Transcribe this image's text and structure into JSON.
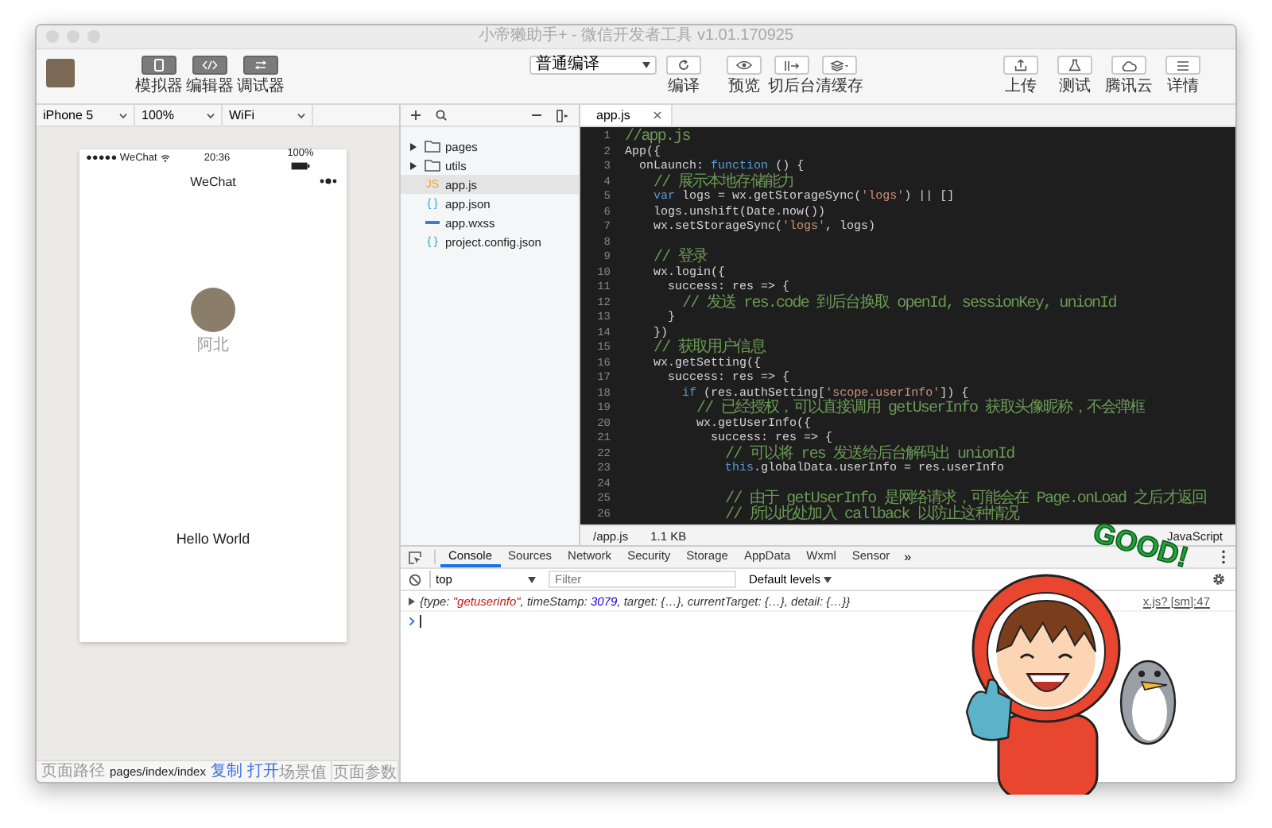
{
  "window": {
    "title": "小帝獭助手+ - 微信开发者工具 v1.01.170925"
  },
  "toolbar": {
    "left_buttons": [
      {
        "label": "模拟器",
        "kind": "simulator"
      },
      {
        "label": "编辑器",
        "kind": "editor"
      },
      {
        "label": "调试器",
        "kind": "debugger"
      }
    ],
    "compile_mode": "普通编译",
    "center_buttons": [
      {
        "label": "编译",
        "kind": "refresh"
      },
      {
        "label": "预览",
        "kind": "eye"
      },
      {
        "label": "切后台",
        "kind": "background"
      },
      {
        "label": "清缓存",
        "kind": "cache"
      }
    ],
    "right_buttons": [
      {
        "label": "上传",
        "kind": "upload"
      },
      {
        "label": "测试",
        "kind": "flask"
      },
      {
        "label": "腾讯云",
        "kind": "cloud"
      },
      {
        "label": "详情",
        "kind": "menu"
      }
    ]
  },
  "device_bar": {
    "device": "iPhone 5",
    "zoom": "100%",
    "network": "WiFi"
  },
  "simulator": {
    "carrier": "●●●●● WeChat",
    "time": "20:36",
    "battery": "100%",
    "nav_title": "WeChat",
    "user_name": "阿北",
    "greeting": "Hello World"
  },
  "path_bar": {
    "label": "页面路径",
    "path": "pages/index/index",
    "links": [
      "复制",
      "打开"
    ],
    "scene": "场景值",
    "params": "页面参数"
  },
  "file_tree": {
    "items": [
      {
        "name": "pages",
        "kind": "folder",
        "expanded": false,
        "selected": false
      },
      {
        "name": "utils",
        "kind": "folder",
        "expanded": false,
        "selected": false
      },
      {
        "name": "app.js",
        "kind": "js",
        "badge": "JS",
        "selected": true
      },
      {
        "name": "app.json",
        "kind": "json",
        "badge": "{ }",
        "selected": false
      },
      {
        "name": "app.wxss",
        "kind": "wxss",
        "selected": false
      },
      {
        "name": "project.config.json",
        "kind": "json",
        "badge": "{ }",
        "selected": false
      }
    ]
  },
  "editor": {
    "tabs": [
      {
        "label": "app.js",
        "selected": true
      }
    ],
    "lines": [
      {
        "number": "1",
        "tokens": [
          {
            "kind": "comment",
            "text": "//app.js"
          }
        ]
      },
      {
        "number": "2",
        "tokens": [
          {
            "kind": "plain",
            "text": "App({"
          }
        ]
      },
      {
        "number": "3",
        "tokens": [
          {
            "kind": "plain",
            "text": "  onLaunch: "
          },
          {
            "kind": "keyword",
            "text": "function"
          },
          {
            "kind": "plain",
            "text": " () {"
          }
        ]
      },
      {
        "number": "4",
        "tokens": [
          {
            "kind": "comment",
            "text": "    // 展示本地存储能力"
          }
        ]
      },
      {
        "number": "5",
        "tokens": [
          {
            "kind": "keyword",
            "text": "    var"
          },
          {
            "kind": "plain",
            "text": " logs = wx.getStorageSync("
          },
          {
            "kind": "string",
            "text": "'logs'"
          },
          {
            "kind": "plain",
            "text": ") || []"
          }
        ]
      },
      {
        "number": "6",
        "tokens": [
          {
            "kind": "plain",
            "text": "    logs.unshift(Date.now())"
          }
        ]
      },
      {
        "number": "7",
        "tokens": [
          {
            "kind": "plain",
            "text": "    wx.setStorageSync("
          },
          {
            "kind": "string",
            "text": "'logs'"
          },
          {
            "kind": "plain",
            "text": ", logs)"
          }
        ]
      },
      {
        "number": "8"
      },
      {
        "number": "9",
        "tokens": [
          {
            "kind": "comment",
            "text": "    // 登录"
          }
        ]
      },
      {
        "number": "10",
        "tokens": [
          {
            "kind": "plain",
            "text": "    wx.login({"
          }
        ]
      },
      {
        "number": "11",
        "tokens": [
          {
            "kind": "plain",
            "text": "      success: res => {"
          }
        ]
      },
      {
        "number": "12",
        "tokens": [
          {
            "kind": "comment",
            "text": "        // 发送 res.code 到后台换取 openId, sessionKey, unionId"
          }
        ]
      },
      {
        "number": "13",
        "tokens": [
          {
            "kind": "plain",
            "text": "      }"
          }
        ]
      },
      {
        "number": "14",
        "tokens": [
          {
            "kind": "plain",
            "text": "    })"
          }
        ]
      },
      {
        "number": "15",
        "tokens": [
          {
            "kind": "comment",
            "text": "    // 获取用户信息"
          }
        ]
      },
      {
        "number": "16",
        "tokens": [
          {
            "kind": "plain",
            "text": "    wx.getSetting({"
          }
        ]
      },
      {
        "number": "17",
        "tokens": [
          {
            "kind": "plain",
            "text": "      success: res => {"
          }
        ]
      },
      {
        "number": "18",
        "tokens": [
          {
            "kind": "keyword",
            "text": "        if"
          },
          {
            "kind": "plain",
            "text": " (res.authSetting["
          },
          {
            "kind": "string",
            "text": "'scope.userInfo'"
          },
          {
            "kind": "plain",
            "text": "]) {"
          }
        ]
      },
      {
        "number": "19",
        "tokens": [
          {
            "kind": "comment",
            "text": "          // 已经授权，可以直接调用 getUserInfo 获取头像昵称，不会弹框"
          }
        ]
      },
      {
        "number": "20",
        "tokens": [
          {
            "kind": "plain",
            "text": "          wx.getUserInfo({"
          }
        ]
      },
      {
        "number": "21",
        "tokens": [
          {
            "kind": "plain",
            "text": "            success: res => {"
          }
        ]
      },
      {
        "number": "22",
        "tokens": [
          {
            "kind": "comment",
            "text": "              // 可以将 res 发送给后台解码出 unionId"
          }
        ]
      },
      {
        "number": "23",
        "tokens": [
          {
            "kind": "keyword",
            "text": "              this"
          },
          {
            "kind": "plain",
            "text": ".globalData.userInfo = res.userInfo"
          }
        ]
      },
      {
        "number": "24"
      },
      {
        "number": "25",
        "tokens": [
          {
            "kind": "comment",
            "text": "              // 由于 getUserInfo 是网络请求，可能会在 Page.onLoad 之后才返回"
          }
        ]
      },
      {
        "number": "26",
        "tokens": [
          {
            "kind": "comment",
            "text": "              // 所以此处加入 callback 以防止这种情况"
          }
        ]
      }
    ],
    "status": {
      "path": "/app.js",
      "size": "1.1 KB",
      "language": "JavaScript"
    }
  },
  "devtools": {
    "tabs": [
      {
        "label": "Console",
        "selected": true
      },
      {
        "label": "Sources",
        "selected": false
      },
      {
        "label": "Network",
        "selected": false
      },
      {
        "label": "Security",
        "selected": false
      },
      {
        "label": "Storage",
        "selected": false
      },
      {
        "label": "AppData",
        "selected": false
      },
      {
        "label": "Wxml",
        "selected": false
      },
      {
        "label": "Sensor",
        "selected": false
      }
    ],
    "more": "»",
    "context": "top",
    "filter_placeholder": "Filter",
    "levels": "Default levels",
    "log": [
      {
        "tokens": [
          {
            "kind": "plain",
            "text": "{type: "
          },
          {
            "kind": "string",
            "text": "\"getuserinfo\""
          },
          {
            "kind": "plain",
            "text": ", timeStamp: "
          },
          {
            "kind": "number",
            "text": "3079"
          },
          {
            "kind": "plain",
            "text": ", target: {…}, currentTarget: {…}, detail: {…}}"
          }
        ],
        "source": "x.js? [sm]:47"
      }
    ]
  },
  "sticker": {
    "text": "GOOD!"
  }
}
